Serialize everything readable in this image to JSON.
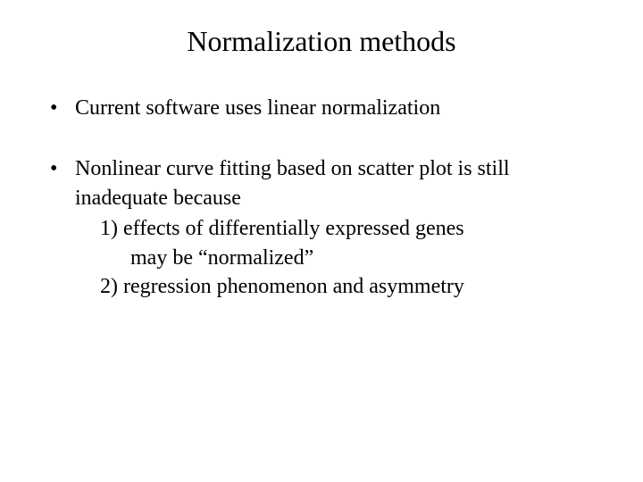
{
  "title": "Normalization methods",
  "bullets": [
    {
      "text": "Current software uses linear normalization"
    },
    {
      "text": "Nonlinear curve fitting based on scatter plot is still inadequate because",
      "sub": [
        {
          "num": "1)",
          "line1": "effects of differentially expressed genes",
          "line2": "may be “normalized”"
        },
        {
          "num": "2)",
          "line1": "regression phenomenon and asymmetry"
        }
      ]
    }
  ]
}
